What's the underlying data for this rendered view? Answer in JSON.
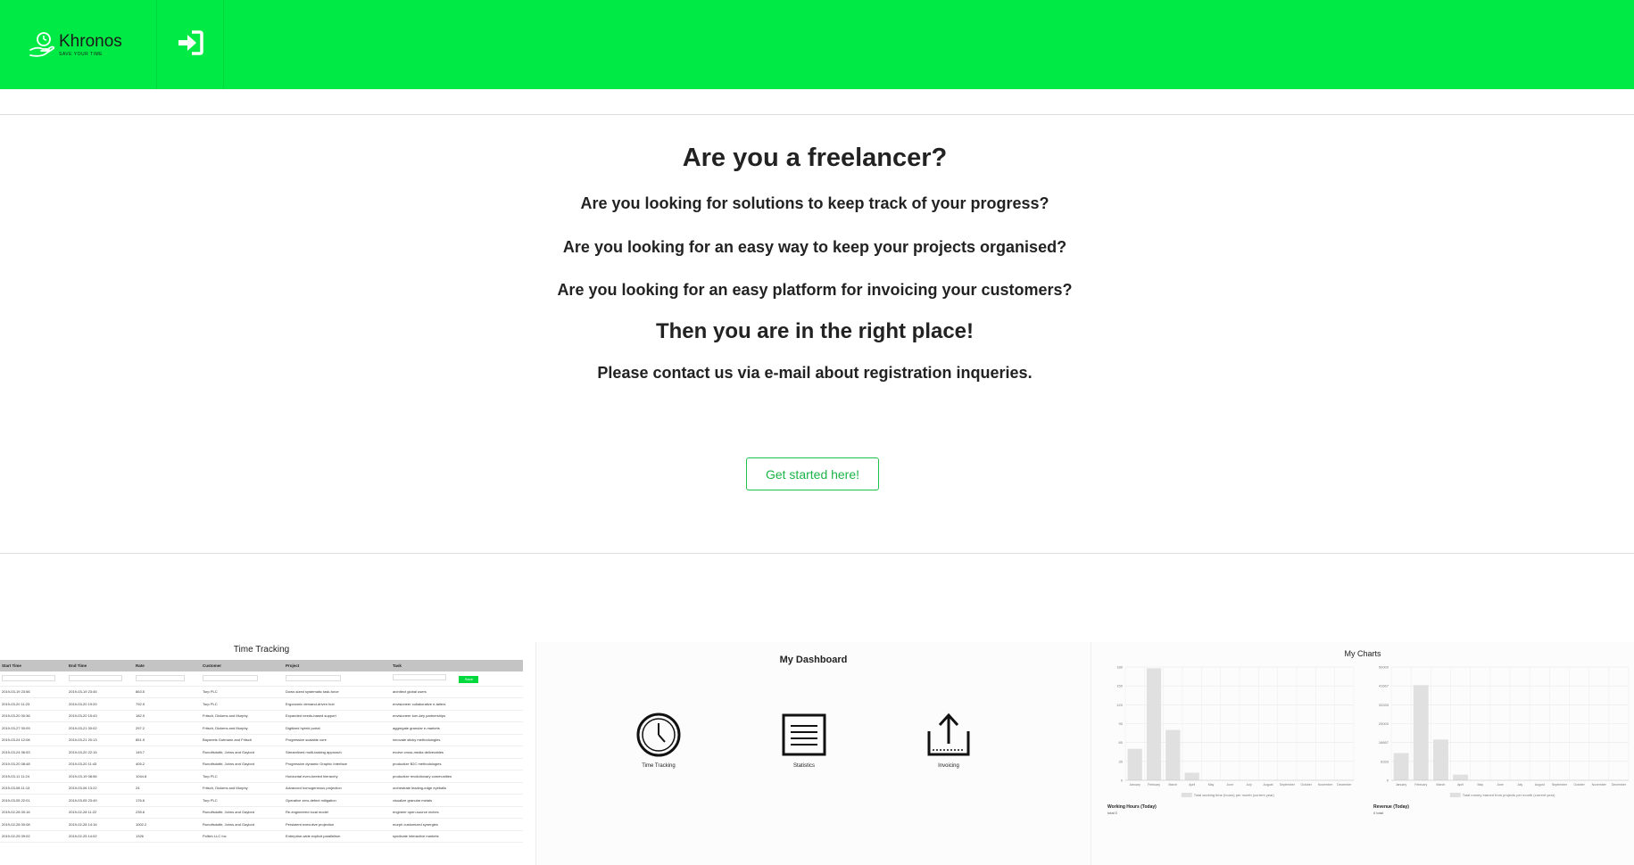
{
  "header": {
    "brand_name": "Khronos",
    "brand_tagline": "SAVE YOUR TIME",
    "login_icon": "sign-in-icon",
    "accent_color": "#00ea45"
  },
  "hero": {
    "title": "Are you a freelancer?",
    "question_1": "Are you looking for solutions to keep track of your progress?",
    "question_2": "Are you looking for an easy way to keep your projects organised?",
    "question_3": "Are you looking for an easy platform for invoicing your customers?",
    "subtitle": "Then you are in the right place!",
    "contact": "Please contact us via e-mail about registration inqueries.",
    "cta_label": "Get started here!"
  },
  "preview_time_tracking": {
    "title": "Time Tracking",
    "columns": [
      "Start Time",
      "End Time",
      "Rate",
      "Customer",
      "Project",
      "Task"
    ],
    "save_label": "Save",
    "rows": [
      [
        "2019-03-19 23:56",
        "2019-03-19 23:45",
        "863.5",
        "Torp PLC",
        "Down-sized systematic task-force",
        "architect global users"
      ],
      [
        "2019-03-20 11:23",
        "2019-03-20 19:20",
        "792.9",
        "Torp PLC",
        "Ergonomic demand-driven hub",
        "envisioneer collaborative e-tailers"
      ],
      [
        "2019-03-20 00:36",
        "2019-03-20 15:43",
        "182.9",
        "Fritsch, Dickens and Murphy",
        "Expanded needs-based support",
        "envisioneer turn-key partnerships"
      ],
      [
        "2019-03-27 00:09",
        "2019-03-21 00:02",
        "297.2",
        "Fritsch, Dickens and Murphy",
        "Digitized hybrid portal",
        "aggregate granular e-markets"
      ],
      [
        "2019-03-24 12:08",
        "2019-03-21 20:13",
        "851.9",
        "Bayonets Gutmann and Fritsch",
        "Progressive scalable core",
        "innovate sticky methodologies"
      ],
      [
        "2019-03-24 06:53",
        "2019-03-20 22:15",
        "149.7",
        "Runolfsdottir, Johns and Gaylord",
        "Streamlined multi-tasking approach",
        "evolve cross-media deliverables"
      ],
      [
        "2019-03-20 08:48",
        "2019-03-20 11:43",
        "405.2",
        "Runolfsdottir, Johns and Gaylord",
        "Progressive dynamic Graphic Interface",
        "productize B2C methodologies"
      ],
      [
        "2019-03-11 11:24",
        "2019-03-19 08:56",
        "1044.8",
        "Torp PLC",
        "Horizontal even-keeled hierarchy",
        "productize revolutionary communities"
      ],
      [
        "2019-03-08 11:13",
        "2019-03-06 13:22",
        "24",
        "Fritsch, Dickens and Murphy",
        "Advanced homogeneous projection",
        "orchestrate leading-edge eyeballs"
      ],
      [
        "2019-03-05 22:01",
        "2019-03-05 23:49",
        "176.6",
        "Torp PLC",
        "Operative zero-defect mitigation",
        "visualize granular metals"
      ],
      [
        "2019-02-28 00:16",
        "2019-02-28 11:22",
        "235.6",
        "Runolfsdottir, Johns and Gaylord",
        "Re-engineered local model",
        "engineer open-source niches"
      ],
      [
        "2019-02-28 00:08",
        "2019-02-28 14:16",
        "1002.2",
        "Runolfsdottir, Johns and Gaylord",
        "Persistent executive projection",
        "morph customized synergies"
      ],
      [
        "2019-02-25 09:02",
        "2019-02-25 14:02",
        "1326",
        "Pollich LLC Inc",
        "Enterprise-wide explicit parallelism",
        "syndicate interactive markets"
      ]
    ]
  },
  "preview_dashboard": {
    "title": "My Dashboard",
    "items": [
      {
        "label": "Time Tracking",
        "icon": "clock-icon"
      },
      {
        "label": "Statistics",
        "icon": "list-icon"
      },
      {
        "label": "Invoicing",
        "icon": "export-icon"
      }
    ]
  },
  "preview_charts": {
    "title": "My Charts",
    "left_footer_label": "Working Hours (Today)",
    "left_footer_value": "total 0",
    "right_footer_label": "Revenue (Today)",
    "right_footer_value": "0 total"
  },
  "chart_data": [
    {
      "type": "bar",
      "categories": [
        "January",
        "February",
        "March",
        "April",
        "May",
        "June",
        "July",
        "August",
        "September",
        "October",
        "November",
        "December"
      ],
      "values": [
        50,
        178,
        80,
        12,
        0,
        0,
        0,
        0,
        0,
        0,
        0,
        0
      ],
      "ylim": [
        0,
        180
      ],
      "legend": "Total working time (hours) per month (current year)"
    },
    {
      "type": "bar",
      "categories": [
        "January",
        "February",
        "March",
        "April",
        "May",
        "June",
        "July",
        "August",
        "September",
        "October",
        "November",
        "December"
      ],
      "values": [
        12000,
        42000,
        18000,
        2500,
        0,
        0,
        0,
        0,
        0,
        0,
        0,
        0
      ],
      "ylim": [
        0,
        50000
      ],
      "legend": "Total money earned from projects per month (current year)"
    }
  ]
}
